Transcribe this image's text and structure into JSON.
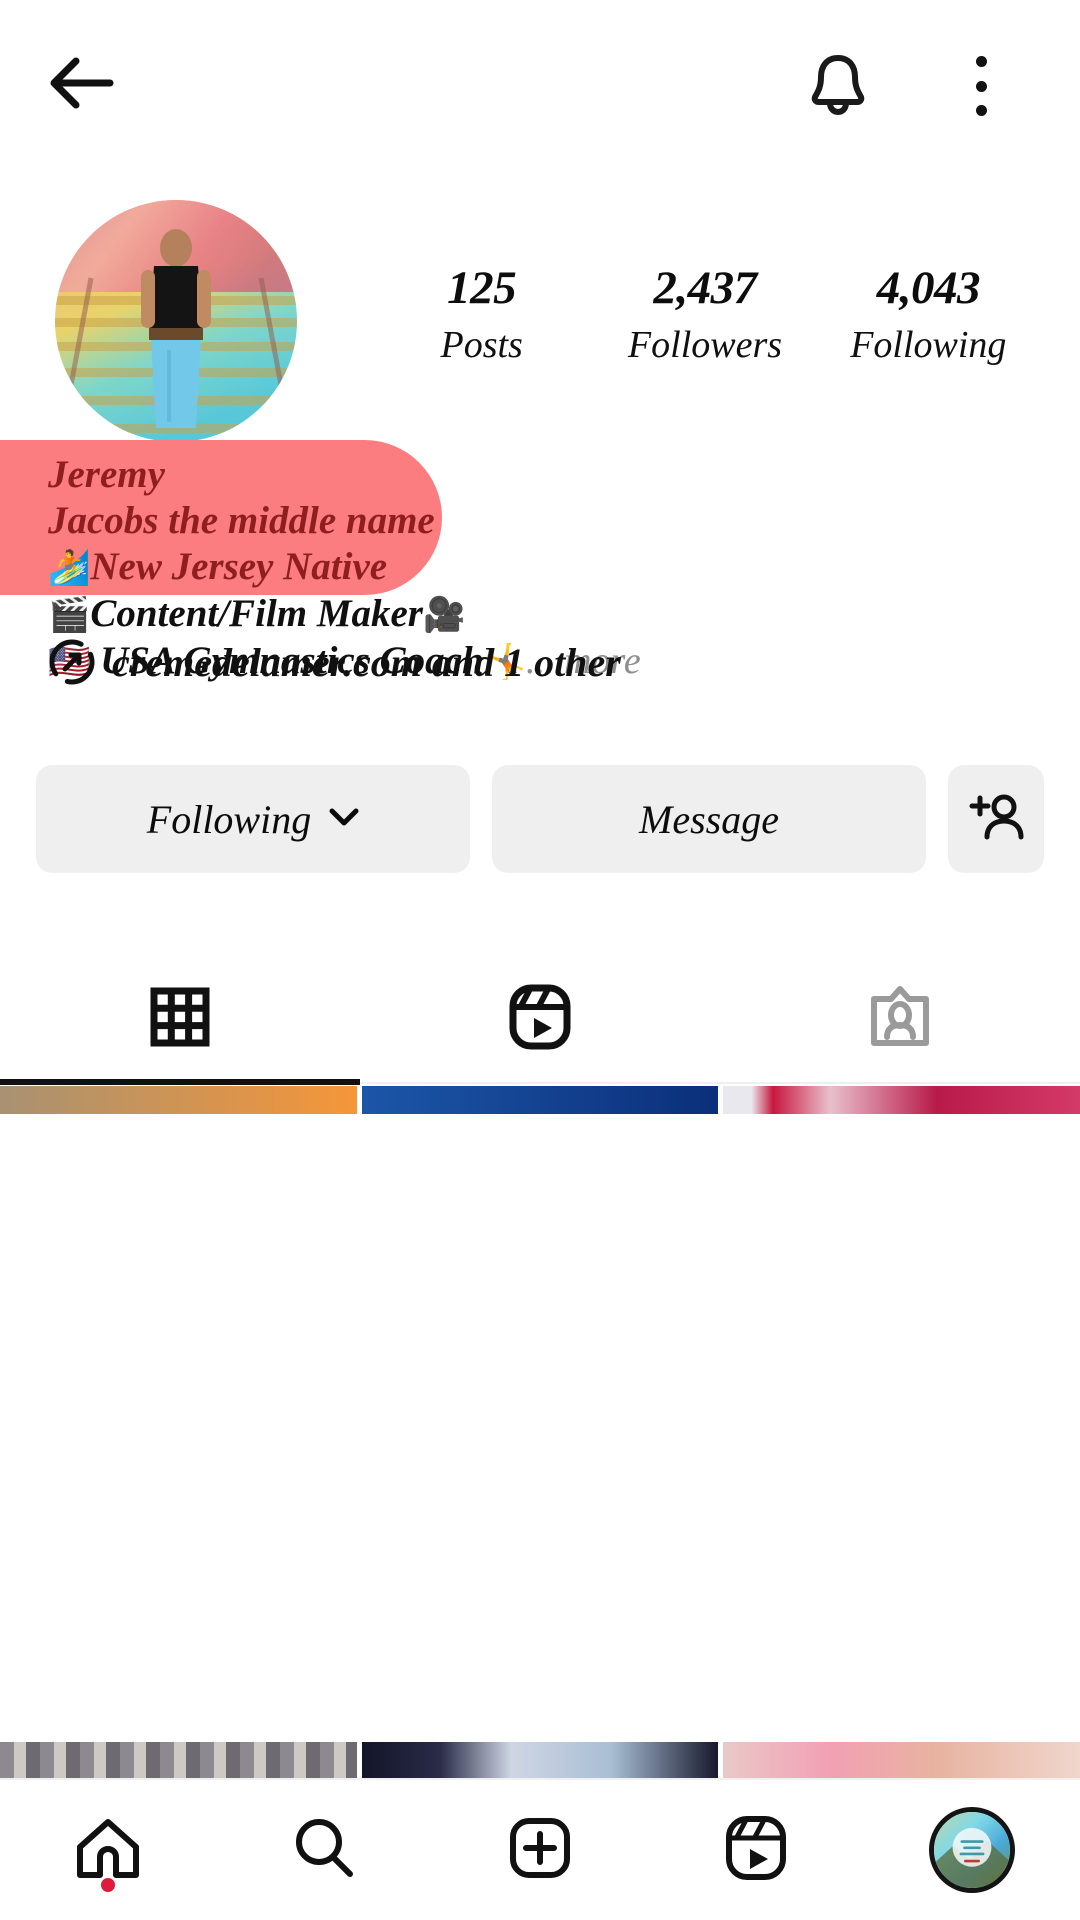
{
  "topbar": {
    "back_icon": "back-arrow-icon",
    "bell_icon": "bell-icon",
    "menu_icon": "three-dots-menu-icon"
  },
  "profile": {
    "avatar_alt": "profile-picture",
    "stats": [
      {
        "value": "125",
        "label": "Posts"
      },
      {
        "value": "2,437",
        "label": "Followers"
      },
      {
        "value": "4,043",
        "label": "Following"
      }
    ],
    "bio": {
      "highlight_color": "#fb7d7f",
      "highlight_text_color": "#8f1f1f",
      "lines": [
        {
          "text": "Jeremy",
          "highlighted": true,
          "emoji": ""
        },
        {
          "text": "Jacobs the middle name",
          "highlighted": true,
          "emoji": ""
        },
        {
          "text": "New Jersey Native",
          "highlighted": true,
          "emoji": "🏄"
        },
        {
          "text": "Content/Film Maker",
          "highlighted": false,
          "emoji": "🎬",
          "emoji_after": "🎥"
        },
        {
          "text": "USA Gymnastics Coach",
          "highlighted": false,
          "emoji": "🇺🇸",
          "emoji_after": "🤸"
        }
      ],
      "more_label": "... more"
    },
    "link": {
      "icon": "link-icon",
      "text": "cremedelamer.com and 1 other"
    }
  },
  "actions": {
    "following_label": "Following",
    "following_chevron": "chevron-down-icon",
    "message_label": "Message",
    "adduser_icon": "add-person-icon"
  },
  "tabs": [
    {
      "name": "grid",
      "icon": "grid-icon",
      "active": true
    },
    {
      "name": "reels",
      "icon": "reels-icon",
      "active": true
    },
    {
      "name": "tagged",
      "icon": "tagged-icon",
      "active": false
    }
  ],
  "grid_top": [
    {
      "color_from": "#a89272",
      "color_to": "#f59638"
    },
    {
      "color_from": "#1c56a8",
      "color_to": "#0b2f7a"
    },
    {
      "color_from": "#e8e8ee",
      "color_to": "#b81a49"
    }
  ],
  "grid_bottom": [
    {
      "color_from": "#8c8a90",
      "color_to": "#cfc9c4"
    },
    {
      "color_from": "#121428",
      "color_to": "#a9bed4"
    },
    {
      "color_from": "#e9c9c8",
      "color_to": "#f0a0a8"
    }
  ],
  "bottomnav": [
    {
      "name": "home",
      "icon": "home-icon",
      "badge": true
    },
    {
      "name": "search",
      "icon": "search-icon",
      "badge": false
    },
    {
      "name": "create",
      "icon": "plus-box-icon",
      "badge": false
    },
    {
      "name": "reels",
      "icon": "reels-icon",
      "badge": false
    },
    {
      "name": "profile",
      "icon": "avatar-icon",
      "badge": false
    }
  ]
}
